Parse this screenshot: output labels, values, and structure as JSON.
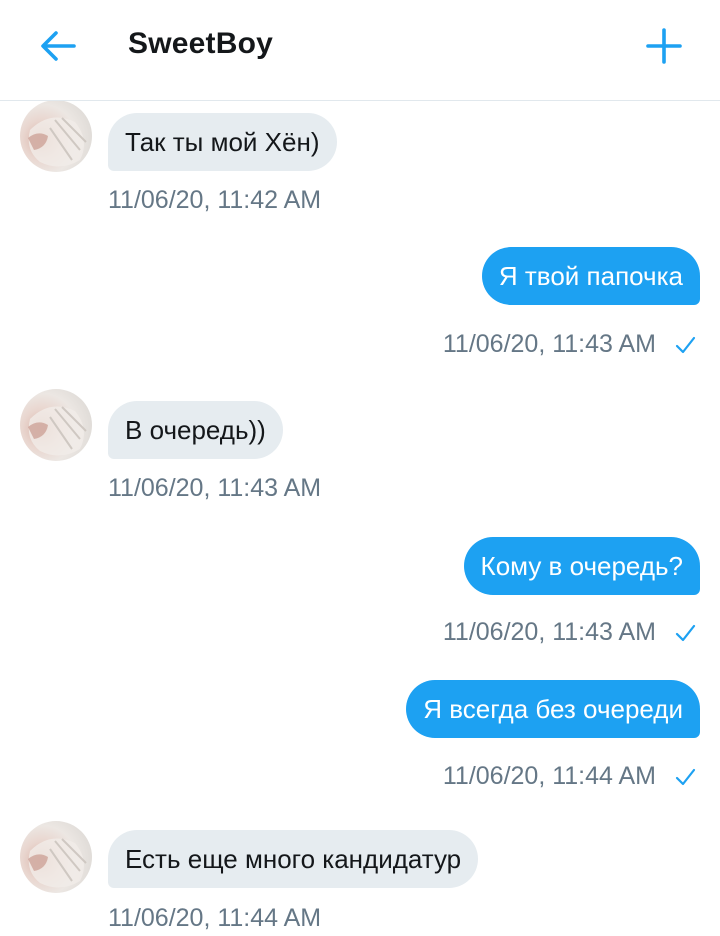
{
  "header": {
    "title": "SweetBoy",
    "back_icon": "arrow-left-icon",
    "add_icon": "plus-icon",
    "accent_color": "#1da1f2"
  },
  "messages": [
    {
      "direction": "incoming",
      "text": "Так ты мой Хён)",
      "time": "11/06/20, 11:42 AM"
    },
    {
      "direction": "outgoing",
      "text": "Я твой папочка",
      "time": "11/06/20, 11:43 AM",
      "status_icon": "check-icon"
    },
    {
      "direction": "incoming",
      "text": "В очередь))",
      "time": "11/06/20, 11:43 AM"
    },
    {
      "direction": "outgoing",
      "text": "Кому в очередь?",
      "time": "11/06/20, 11:43 AM",
      "status_icon": "check-icon"
    },
    {
      "direction": "outgoing",
      "text": "Я всегда без очереди",
      "time": "11/06/20, 11:44 AM",
      "status_icon": "check-icon"
    },
    {
      "direction": "incoming",
      "text": "Есть еще много кандидатур",
      "time": "11/06/20, 11:44 AM"
    }
  ]
}
